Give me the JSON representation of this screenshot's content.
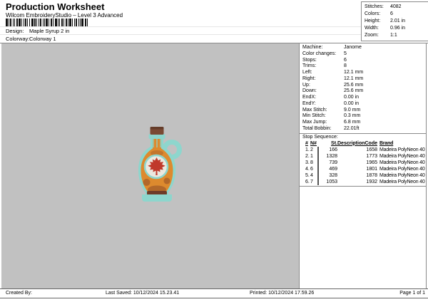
{
  "header": {
    "title": "Production Worksheet",
    "subtitle": "Wilcom EmbroideryStudio – Level 3 Advanced",
    "design_label": "Design:",
    "design_value": "Maple Syrup 2 in",
    "colorway_label": "Colorway:",
    "colorway_value": "Colorway 1"
  },
  "summary": {
    "rows": [
      {
        "label": "Stitches:",
        "value": "4082"
      },
      {
        "label": "Colors:",
        "value": "6"
      },
      {
        "label": "Height:",
        "value": "2.01 in"
      },
      {
        "label": "Width:",
        "value": "0.96 in"
      },
      {
        "label": "Zoom:",
        "value": "1:1"
      }
    ]
  },
  "machine": {
    "rows": [
      {
        "label": "Machine:",
        "value": "Janome"
      },
      {
        "label": "Color changes:",
        "value": "5"
      },
      {
        "label": "Stops:",
        "value": "6"
      },
      {
        "label": "Trims:",
        "value": "8"
      },
      {
        "label": "Left:",
        "value": "12.1 mm"
      },
      {
        "label": "Right:",
        "value": "12.1 mm"
      },
      {
        "label": "Up:",
        "value": "25.6 mm"
      },
      {
        "label": "Down:",
        "value": "25.6 mm"
      },
      {
        "label": "EndX:",
        "value": "0.00 in"
      },
      {
        "label": "EndY:",
        "value": "0.00 in"
      },
      {
        "label": "Max Stitch:",
        "value": "9.0 mm"
      },
      {
        "label": "Min Stitch:",
        "value": "0.3 mm"
      },
      {
        "label": "Max Jump:",
        "value": "6.8 mm"
      },
      {
        "label": "Total Bobbin:",
        "value": "22.01ft"
      }
    ]
  },
  "stop_sequence": {
    "title": "Stop Sequence:",
    "columns": [
      "#",
      "N#",
      "St.",
      "Description",
      "Code",
      "Brand"
    ],
    "rows": [
      {
        "seq": "1.",
        "needle": "2",
        "swatch": "#6e3a26",
        "stitches": "166",
        "description": "",
        "code": "1658",
        "brand": "Madeira PolyNeon 40"
      },
      {
        "seq": "2.",
        "needle": "1",
        "swatch": "#b06a28",
        "stitches": "1328",
        "description": "",
        "code": "1773",
        "brand": "Madeira PolyNeon 40"
      },
      {
        "seq": "3.",
        "needle": "8",
        "swatch": "#e5761e",
        "stitches": "739",
        "description": "",
        "code": "1965",
        "brand": "Madeira PolyNeon 40"
      },
      {
        "seq": "4.",
        "needle": "6",
        "swatch": "#efece3",
        "stitches": "469",
        "description": "",
        "code": "1801",
        "brand": "Madeira PolyNeon 40"
      },
      {
        "seq": "5.",
        "needle": "4",
        "swatch": "#bf2b20",
        "stitches": "328",
        "description": "",
        "code": "1878",
        "brand": "Madeira PolyNeon 40"
      },
      {
        "seq": "6.",
        "needle": "7",
        "swatch": "#8ed7d2",
        "stitches": "1053",
        "description": "",
        "code": "1932",
        "brand": "Madeira PolyNeon 40"
      }
    ]
  },
  "design_preview": {
    "name": "maple-syrup-bottle",
    "colors": {
      "outline": "#8dd6cd",
      "body": "#dd8a2e",
      "cap": "#7a4a33",
      "label": "#ece8df",
      "leaf": "#c0392b",
      "shade": "#b2682a",
      "base": "#6e3b28"
    }
  },
  "footer": {
    "created_by": "Created By:",
    "last_saved": "Last Saved: 10/12/2024 15.23.41",
    "printed": "Printed: 10/12/2024 17.59.26",
    "page": "Page 1 of 1"
  }
}
